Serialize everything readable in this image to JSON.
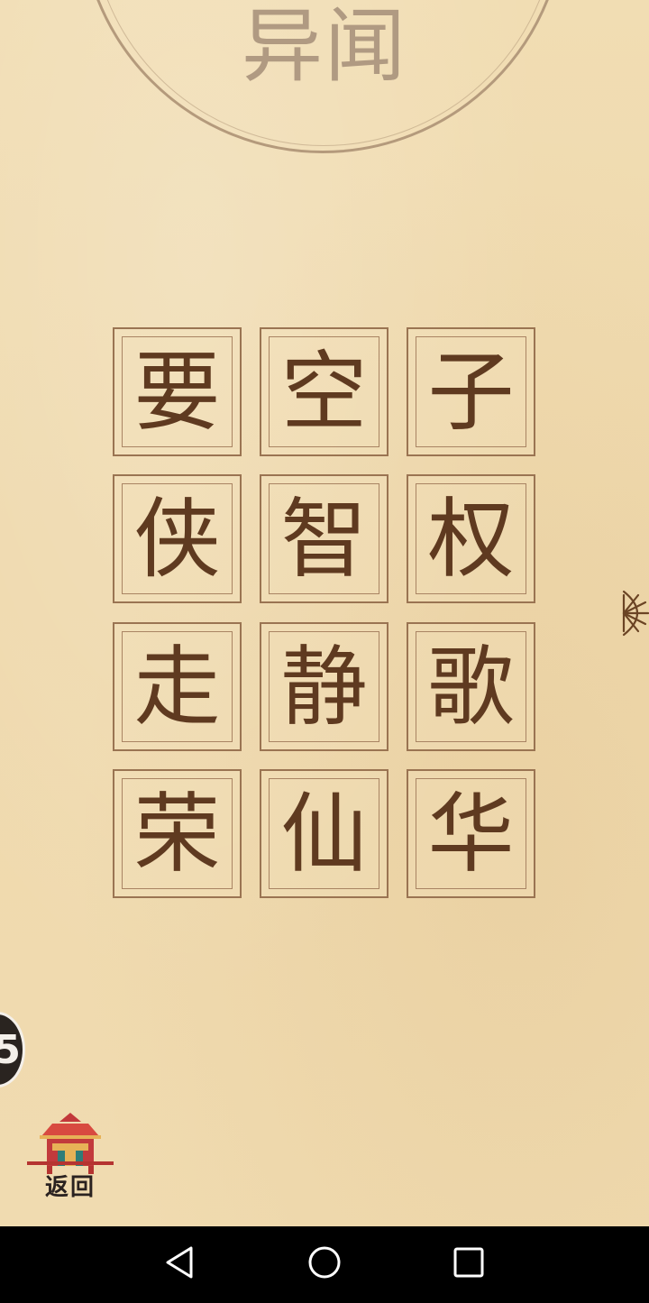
{
  "header": {
    "title": "异闻"
  },
  "tiles": [
    {
      "char": "要"
    },
    {
      "char": "空"
    },
    {
      "char": "子"
    },
    {
      "char": "侠"
    },
    {
      "char": "智"
    },
    {
      "char": "权"
    },
    {
      "char": "走"
    },
    {
      "char": "静"
    },
    {
      "char": "歌"
    },
    {
      "char": "荣"
    },
    {
      "char": "仙"
    },
    {
      "char": "华"
    }
  ],
  "side_badge": {
    "value": "5"
  },
  "back_button": {
    "label": "返回",
    "icon": "pavilion-icon"
  },
  "side_tab": {
    "icon": "fan-icon"
  },
  "nav": {
    "back_icon": "triangle-back-icon",
    "home_icon": "circle-home-icon",
    "recents_icon": "square-recents-icon"
  },
  "colors": {
    "paper": "#f0dbb0",
    "ink": "#5f3a20",
    "frame": "#9a7452",
    "title": "#b09a82"
  }
}
